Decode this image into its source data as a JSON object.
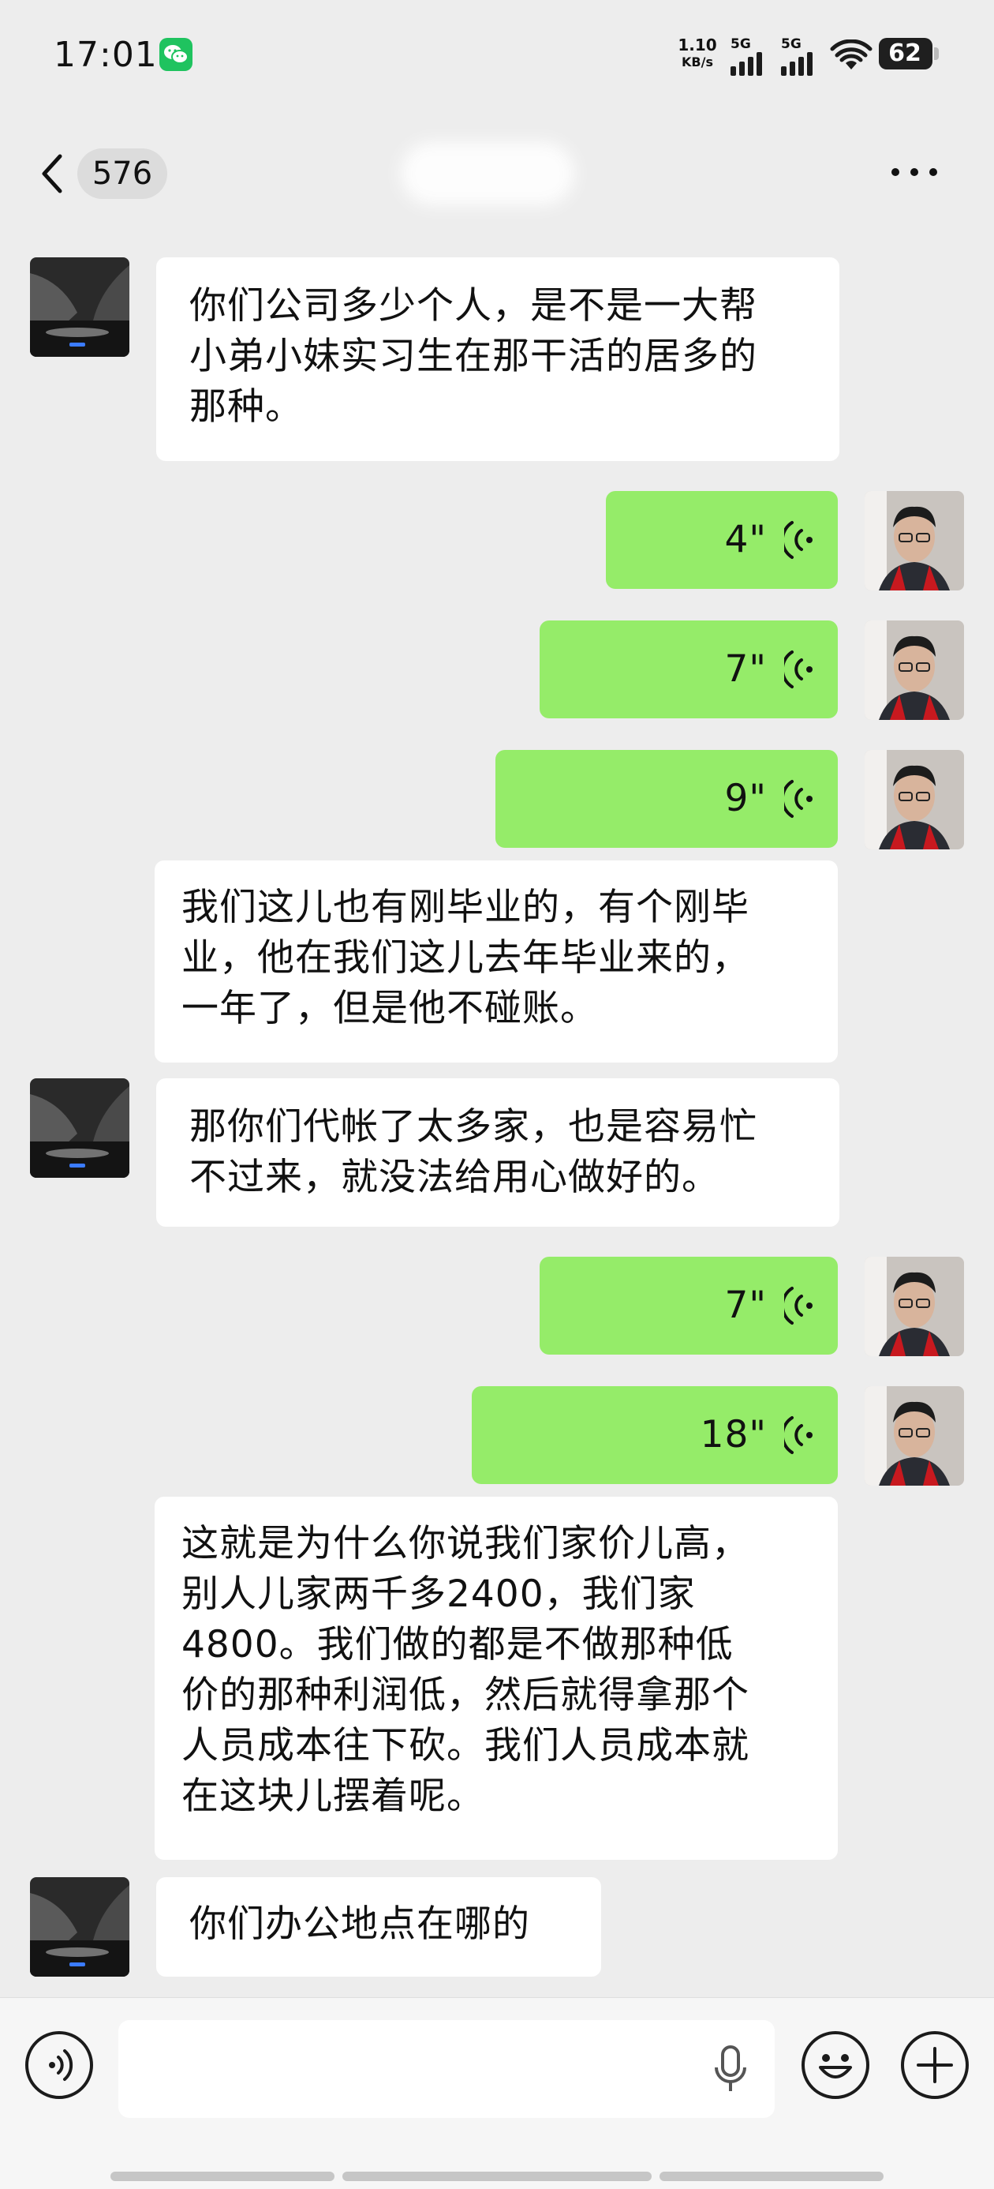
{
  "status_bar": {
    "time": "17:01",
    "app_icon": "wechat-icon",
    "net_speed_value": "1.10",
    "net_speed_unit": "KB/s",
    "signal_1": "5G",
    "signal_2": "5G",
    "battery_level": "62"
  },
  "nav": {
    "back_icon": "chevron-left-icon",
    "unread_count": "576",
    "more_icon": "more-dots-icon"
  },
  "messages": [
    {
      "sender": "other",
      "type": "text",
      "lines": [
        "你们公司多少个人，是不是一大帮",
        "小弟小妹实习生在那干活的居多的",
        "那种。"
      ]
    },
    {
      "sender": "me",
      "type": "voice",
      "duration": "4\""
    },
    {
      "sender": "me",
      "type": "voice",
      "duration": "7\""
    },
    {
      "sender": "me",
      "type": "voice",
      "duration": "9\""
    },
    {
      "sender": "me",
      "type": "text",
      "lines": [
        "我们这儿也有刚毕业的，有个刚毕",
        "业，他在我们这儿去年毕业来的，",
        "一年了，但是他不碰账。"
      ]
    },
    {
      "sender": "other",
      "type": "text",
      "lines": [
        "那你们代帐了太多家，也是容易忙",
        "不过来，就没法给用心做好的。"
      ]
    },
    {
      "sender": "me",
      "type": "voice",
      "duration": "7\""
    },
    {
      "sender": "me",
      "type": "voice",
      "duration": "18\""
    },
    {
      "sender": "me",
      "type": "text",
      "lines": [
        "这就是为什么你说我们家价儿高，",
        "别人儿家两千多2400，我们家",
        "4800。我们做的都是不做那种低",
        "价的那种利润低，然后就得拿那个",
        "人员成本往下砍。我们人员成本就",
        "在这块儿摆着呢。"
      ]
    },
    {
      "sender": "other",
      "type": "text",
      "lines": [
        "你们办公地点在哪的"
      ]
    }
  ],
  "input_bar": {
    "voice_toggle_icon": "voice-mode-icon",
    "message_value": "",
    "mic_icon": "microphone-icon",
    "emoji_icon": "emoji-icon",
    "plus_icon": "plus-icon"
  },
  "colors": {
    "background": "#ededed",
    "my_bubble": "#95ec69",
    "their_bubble": "#ffffff",
    "wechat_green": "#1fc35f"
  }
}
